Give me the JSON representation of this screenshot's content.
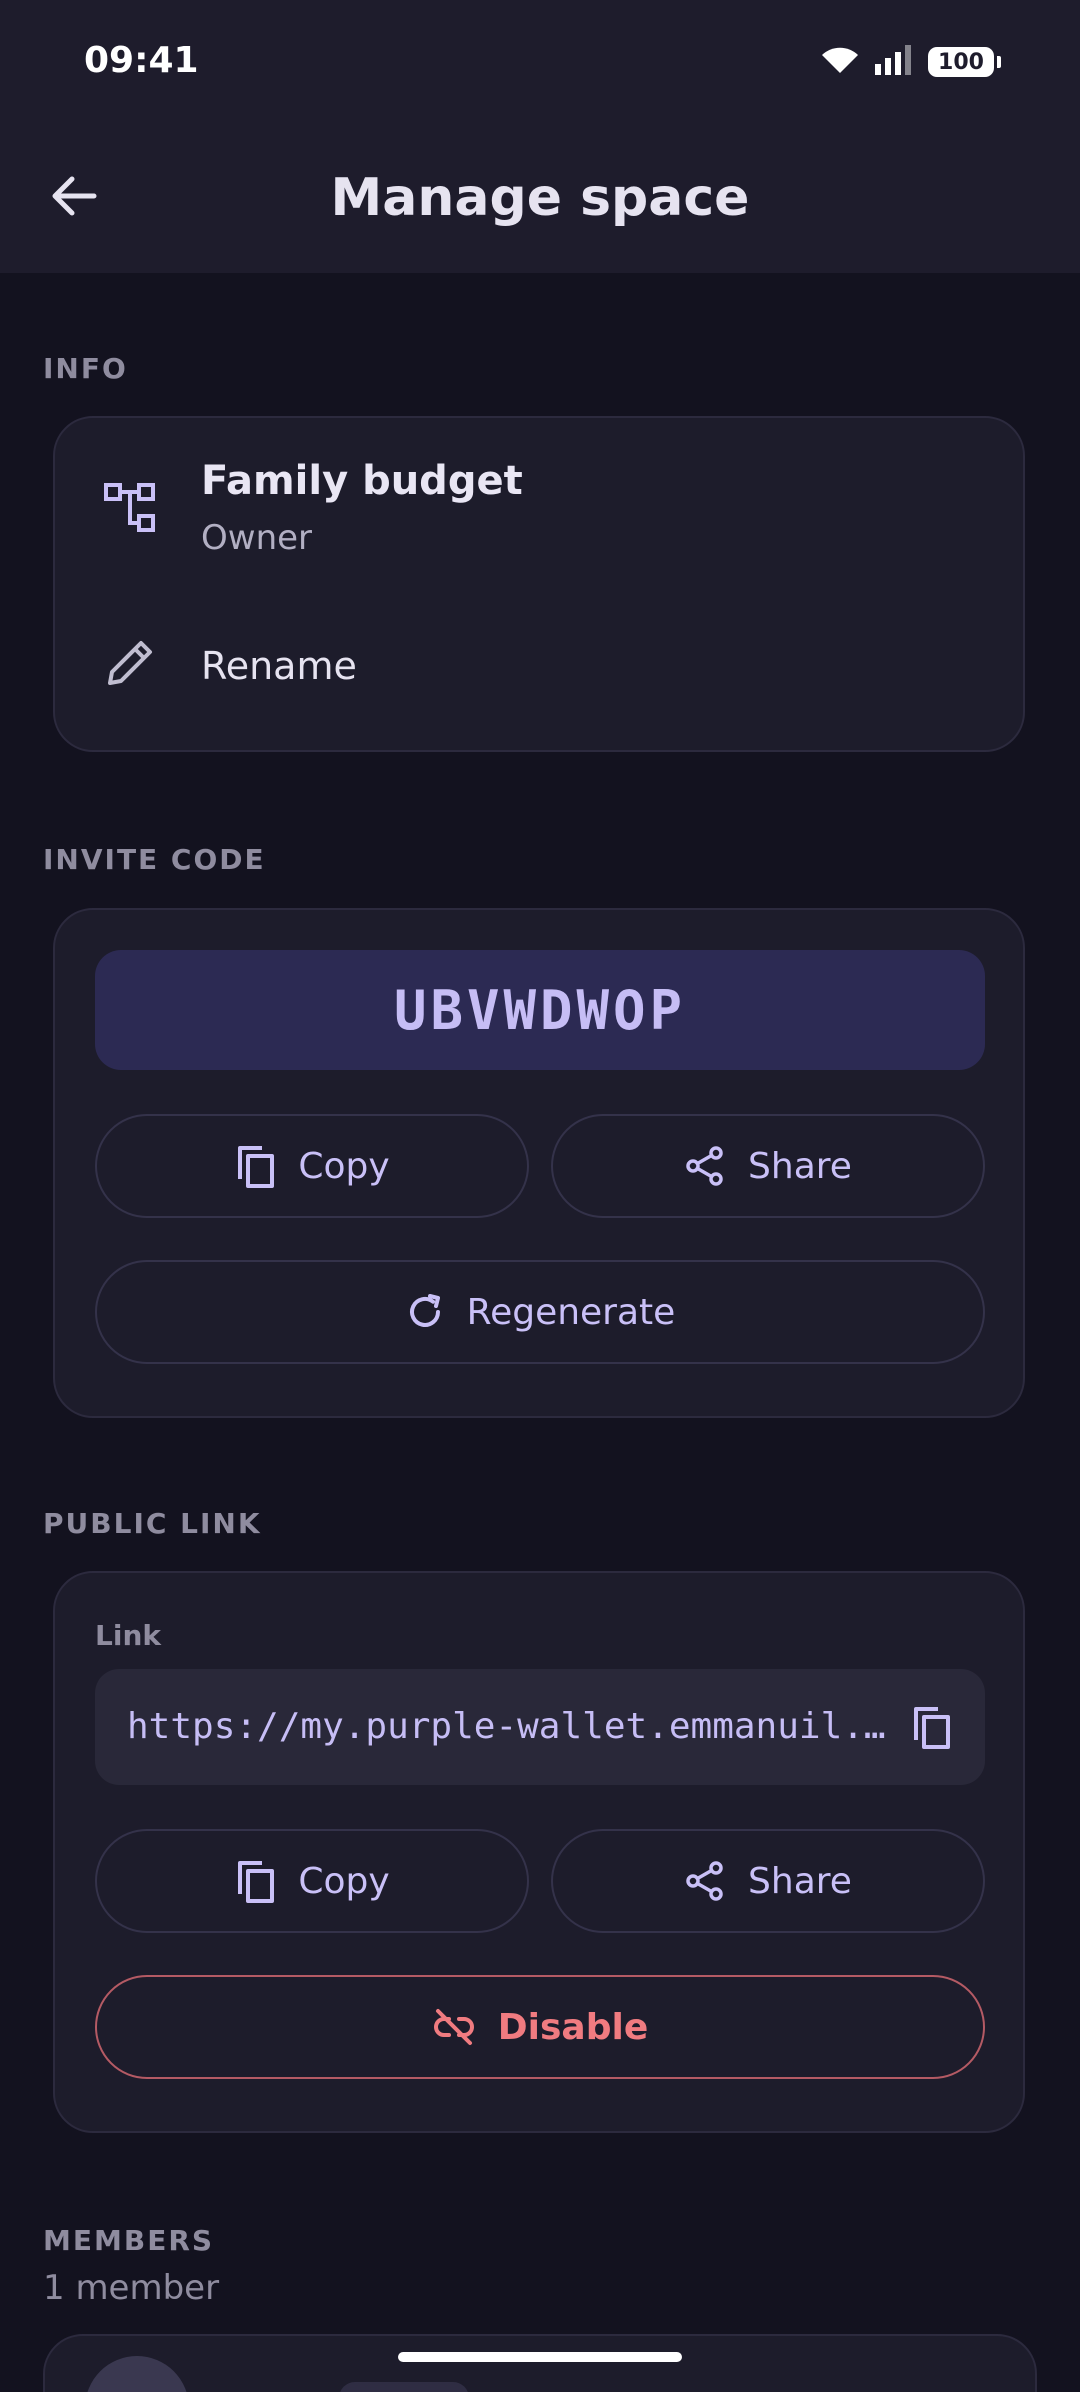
{
  "status_bar": {
    "time": "09:41",
    "battery": "100"
  },
  "header": {
    "title": "Manage space"
  },
  "info": {
    "section_label": "INFO",
    "space_name": "Family budget",
    "role": "Owner",
    "rename_label": "Rename"
  },
  "invite": {
    "section_label": "INVITE CODE",
    "code": "UBVWDWOP",
    "copy_label": "Copy",
    "share_label": "Share",
    "regenerate_label": "Regenerate"
  },
  "public_link": {
    "section_label": "PUBLIC LINK",
    "field_label": "Link",
    "url": "https://my.purple-wallet.emmanuil...",
    "copy_label": "Copy",
    "share_label": "Share",
    "disable_label": "Disable"
  },
  "members": {
    "section_label": "MEMBERS",
    "count_text": "1 member"
  },
  "colors": {
    "accent": "#c9c0f7",
    "danger": "#f07b80",
    "background": "#13121f",
    "card": "#1d1c2b"
  },
  "icons": [
    "back-arrow-icon",
    "space-hierarchy-icon",
    "pencil-icon",
    "copy-icon",
    "share-icon",
    "refresh-icon",
    "link-off-icon",
    "wifi-icon",
    "signal-icon",
    "battery-icon"
  ]
}
